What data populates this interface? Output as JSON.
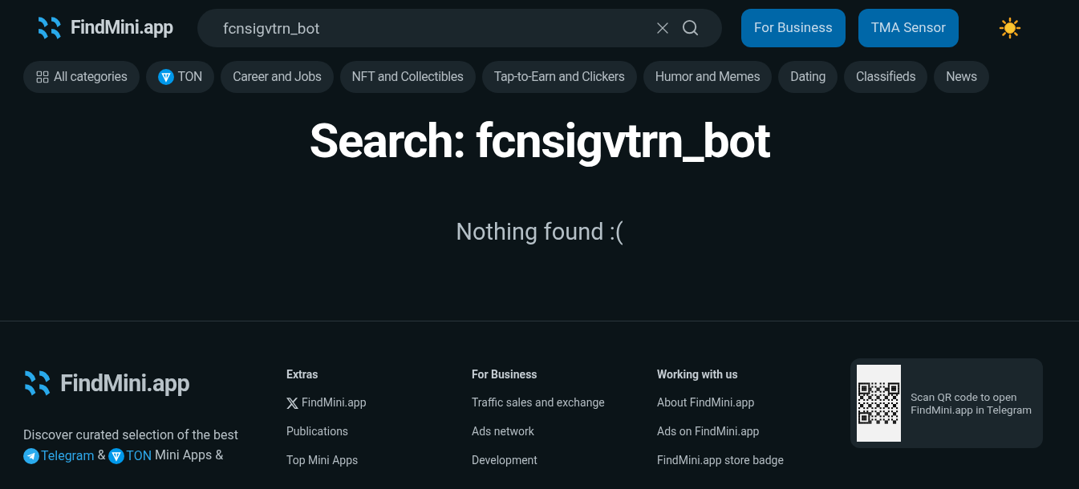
{
  "header": {
    "logo": "FindMini.app",
    "search": {
      "value": "fcnsigvtrn_bot"
    },
    "buttons": [
      "For Business",
      "TMA Sensor"
    ]
  },
  "categories": [
    {
      "label": "All categories",
      "kind": "grid",
      "selected": false
    },
    {
      "label": "TON",
      "kind": "ton",
      "selected": false
    },
    {
      "label": "Career and Jobs",
      "kind": "plain",
      "selected": false
    },
    {
      "label": "NFT and Collectibles",
      "kind": "plain",
      "selected": false
    },
    {
      "label": "Tap-to-Earn and Clickers",
      "kind": "plain",
      "selected": false
    },
    {
      "label": "Humor and Memes",
      "kind": "plain",
      "selected": false
    },
    {
      "label": "Dating",
      "kind": "plain",
      "selected": false
    },
    {
      "label": "Classifieds",
      "kind": "plain",
      "selected": false
    },
    {
      "label": "News",
      "kind": "plain",
      "selected": false
    }
  ],
  "main": {
    "title": "Search: fcnsigvtrn_bot",
    "message": "Nothing found :("
  },
  "footer": {
    "logo": "FindMini.app",
    "description": [
      {
        "kind": "text",
        "text": "Discover curated selection of the best"
      },
      {
        "kind": "break"
      },
      {
        "kind": "telegram",
        "text": "Telegram"
      },
      {
        "kind": "text",
        "text": " & "
      },
      {
        "kind": "ton",
        "text": "TON"
      },
      {
        "kind": "text",
        "text": " Mini Apps &"
      }
    ],
    "columns": [
      {
        "title": "Extras",
        "links": [
          {
            "text": "FindMini.app",
            "kind": "x"
          },
          {
            "text": "Publications"
          },
          {
            "text": "Top Mini Apps"
          }
        ]
      },
      {
        "title": "For Business",
        "links": [
          {
            "text": "Traffic sales and exchange"
          },
          {
            "text": "Ads network"
          },
          {
            "text": "Development"
          }
        ]
      },
      {
        "title": "Working with us",
        "links": [
          {
            "text": "About FindMini.app"
          },
          {
            "text": "Ads on FindMini.app"
          },
          {
            "text": "FindMini.app store badge"
          }
        ]
      }
    ],
    "qr": {
      "caption": "Scan QR code to open FindMini.app in Telegram"
    }
  }
}
